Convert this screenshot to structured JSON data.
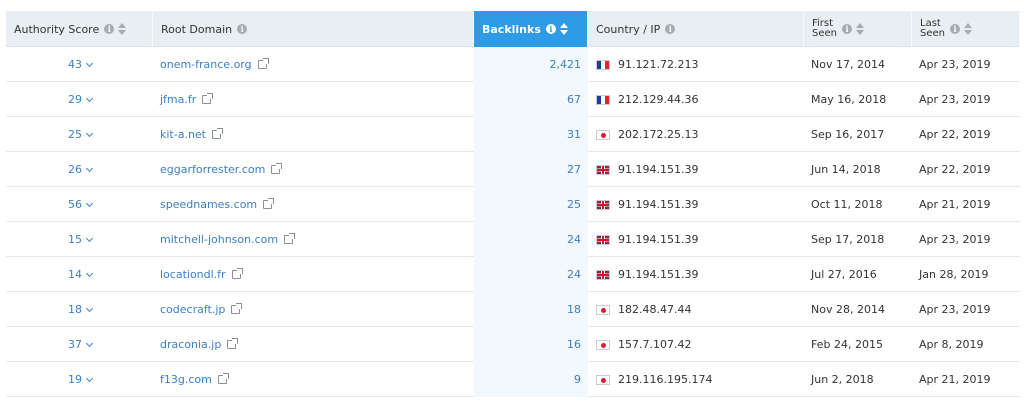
{
  "headers": {
    "authority_score": "Authority Score",
    "root_domain": "Root Domain",
    "backlinks": "Backlinks",
    "country_ip": "Country / IP",
    "first_seen_line1": "First",
    "first_seen_line2": "Seen",
    "last_seen_line1": "Last",
    "last_seen_line2": "Seen"
  },
  "colors": {
    "accent": "#2d9be6",
    "link": "#3b7fc4",
    "header_bg": "#e9eef3"
  },
  "rows": [
    {
      "score": "43",
      "domain": "onem-france.org",
      "backlinks": "2,421",
      "flag": "fr",
      "ip": "91.121.72.213",
      "first_seen": "Nov 17, 2014",
      "last_seen": "Apr 23, 2019"
    },
    {
      "score": "29",
      "domain": "jfma.fr",
      "backlinks": "67",
      "flag": "fr",
      "ip": "212.129.44.36",
      "first_seen": "May 16, 2018",
      "last_seen": "Apr 23, 2019"
    },
    {
      "score": "25",
      "domain": "kit-a.net",
      "backlinks": "31",
      "flag": "jp",
      "ip": "202.172.25.13",
      "first_seen": "Sep 16, 2017",
      "last_seen": "Apr 22, 2019"
    },
    {
      "score": "26",
      "domain": "eggarforrester.com",
      "backlinks": "27",
      "flag": "gb",
      "ip": "91.194.151.39",
      "first_seen": "Jun 14, 2018",
      "last_seen": "Apr 22, 2019"
    },
    {
      "score": "56",
      "domain": "speednames.com",
      "backlinks": "25",
      "flag": "gb",
      "ip": "91.194.151.39",
      "first_seen": "Oct 11, 2018",
      "last_seen": "Apr 21, 2019"
    },
    {
      "score": "15",
      "domain": "mitchell-johnson.com",
      "backlinks": "24",
      "flag": "gb",
      "ip": "91.194.151.39",
      "first_seen": "Sep 17, 2018",
      "last_seen": "Apr 23, 2019"
    },
    {
      "score": "14",
      "domain": "locationdl.fr",
      "backlinks": "24",
      "flag": "gb",
      "ip": "91.194.151.39",
      "first_seen": "Jul 27, 2016",
      "last_seen": "Jan 28, 2019"
    },
    {
      "score": "18",
      "domain": "codecraft.jp",
      "backlinks": "18",
      "flag": "jp",
      "ip": "182.48.47.44",
      "first_seen": "Nov 28, 2014",
      "last_seen": "Apr 23, 2019"
    },
    {
      "score": "37",
      "domain": "draconia.jp",
      "backlinks": "16",
      "flag": "jp",
      "ip": "157.7.107.42",
      "first_seen": "Feb 24, 2015",
      "last_seen": "Apr 8, 2019"
    },
    {
      "score": "19",
      "domain": "f13g.com",
      "backlinks": "9",
      "flag": "jp",
      "ip": "219.116.195.174",
      "first_seen": "Jun 2, 2018",
      "last_seen": "Apr 21, 2019"
    }
  ]
}
